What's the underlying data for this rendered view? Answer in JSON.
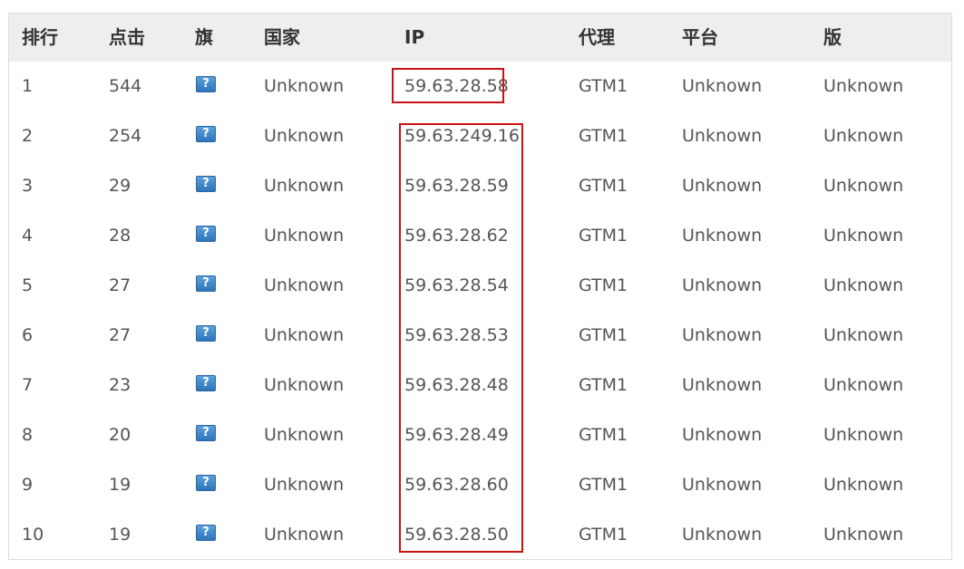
{
  "headers": {
    "rank": "排行",
    "clicks": "点击",
    "flag": "旗",
    "country": "国家",
    "ip": "IP",
    "proxy": "代理",
    "platform": "平台",
    "version": "版"
  },
  "flag_icon": {
    "name": "unknown-flag-icon",
    "glyph": "?"
  },
  "rows": [
    {
      "rank": "1",
      "clicks": "544",
      "country": "Unknown",
      "ip": "59.63.28.58",
      "proxy": "GTM1",
      "platform": "Unknown",
      "version": "Unknown"
    },
    {
      "rank": "2",
      "clicks": "254",
      "country": "Unknown",
      "ip": "59.63.249.16",
      "proxy": "GTM1",
      "platform": "Unknown",
      "version": "Unknown"
    },
    {
      "rank": "3",
      "clicks": "29",
      "country": "Unknown",
      "ip": "59.63.28.59",
      "proxy": "GTM1",
      "platform": "Unknown",
      "version": "Unknown"
    },
    {
      "rank": "4",
      "clicks": "28",
      "country": "Unknown",
      "ip": "59.63.28.62",
      "proxy": "GTM1",
      "platform": "Unknown",
      "version": "Unknown"
    },
    {
      "rank": "5",
      "clicks": "27",
      "country": "Unknown",
      "ip": "59.63.28.54",
      "proxy": "GTM1",
      "platform": "Unknown",
      "version": "Unknown"
    },
    {
      "rank": "6",
      "clicks": "27",
      "country": "Unknown",
      "ip": "59.63.28.53",
      "proxy": "GTM1",
      "platform": "Unknown",
      "version": "Unknown"
    },
    {
      "rank": "7",
      "clicks": "23",
      "country": "Unknown",
      "ip": "59.63.28.48",
      "proxy": "GTM1",
      "platform": "Unknown",
      "version": "Unknown"
    },
    {
      "rank": "8",
      "clicks": "20",
      "country": "Unknown",
      "ip": "59.63.28.49",
      "proxy": "GTM1",
      "platform": "Unknown",
      "version": "Unknown"
    },
    {
      "rank": "9",
      "clicks": "19",
      "country": "Unknown",
      "ip": "59.63.28.60",
      "proxy": "GTM1",
      "platform": "Unknown",
      "version": "Unknown"
    },
    {
      "rank": "10",
      "clicks": "19",
      "country": "Unknown",
      "ip": "59.63.28.50",
      "proxy": "GTM1",
      "platform": "Unknown",
      "version": "Unknown"
    }
  ],
  "colors": {
    "header_bg": "#eeeeee",
    "header_text": "#333333",
    "cell_text": "#555555",
    "highlight_border": "#cc1111",
    "flag_bg": "#3b82c4"
  }
}
